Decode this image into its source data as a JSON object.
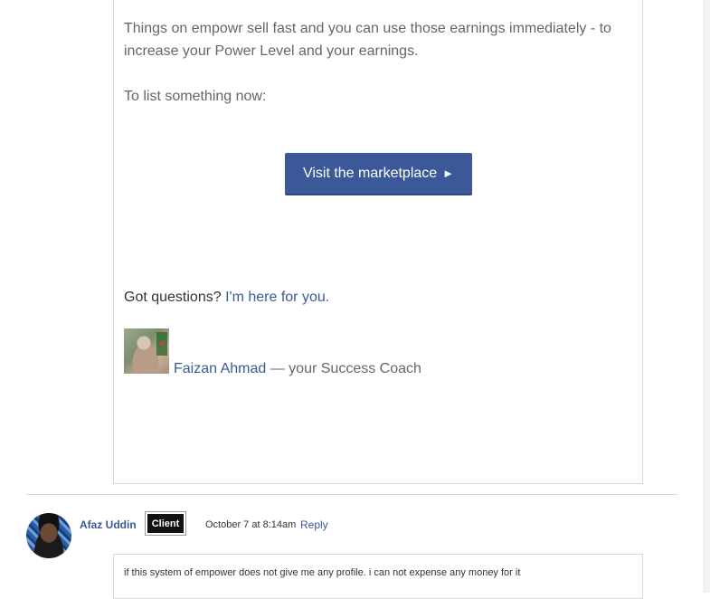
{
  "email": {
    "paragraph1": "Things on empowr sell fast and you can use those earnings immediately - to increase your Power Level and your earnings.",
    "paragraph2": "To list something now:",
    "cta_label": "Visit the marketplace",
    "cta_arrow": "►",
    "questions_text": "Got questions? ",
    "questions_link": "I'm here for you.",
    "coach_name": "Faizan Ahmad",
    "coach_suffix": " — your Success Coach"
  },
  "comment": {
    "author": "Afaz Uddin",
    "badge": "Client",
    "timestamp": "October 7 at 8:14am",
    "reply_label": "Reply",
    "text": "if this system of empower does not give me any profile. i can not expense any money for it"
  },
  "colors": {
    "link": "#3b5998",
    "button": "#3b5998",
    "badge_bg": "#111111"
  }
}
